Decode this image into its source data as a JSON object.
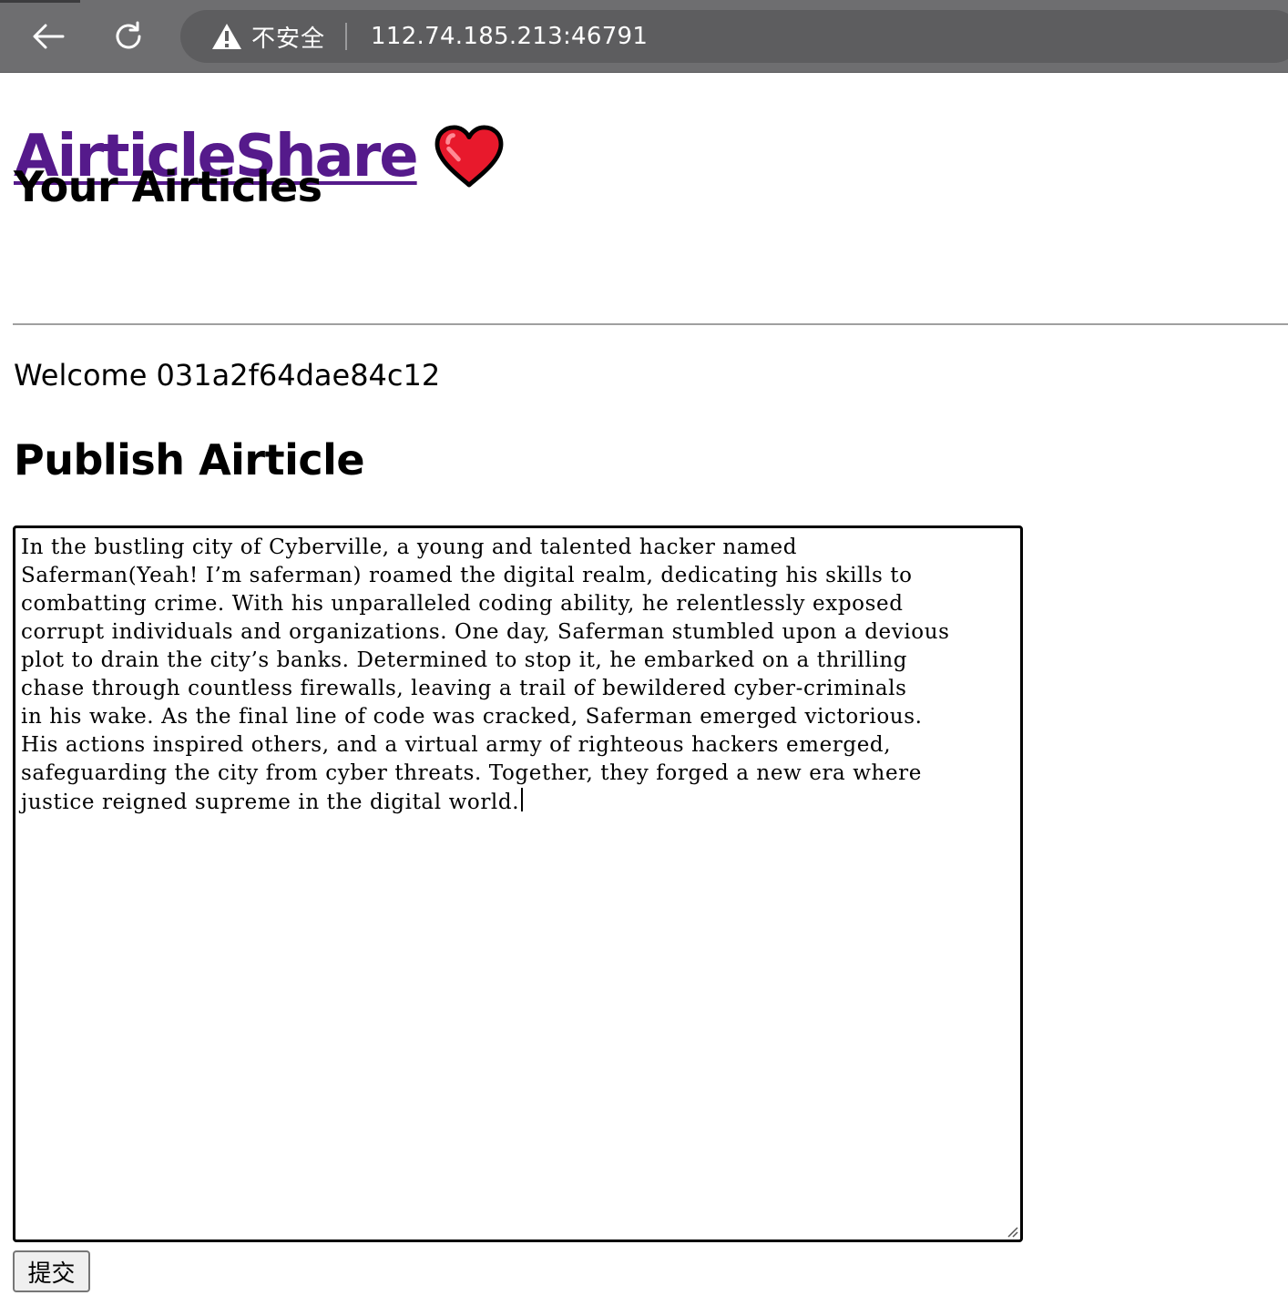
{
  "browser": {
    "security_label": "不安全",
    "url": "112.74.185.213:46791",
    "icons": {
      "back": "arrow-left-icon",
      "reload": "reload-icon",
      "security": "warning-triangle-icon"
    }
  },
  "header": {
    "site_title": "AirticleShare",
    "site_icon": "red-heart-icon"
  },
  "articles": {
    "heading": "Your Airticles"
  },
  "user": {
    "welcome_text": "Welcome 031a2f64dae84c12"
  },
  "publish": {
    "heading": "Publish Airticle",
    "article_lines": [
      "In the bustling city of Cyberville, a young and talented hacker named",
      "Saferman(Yeah! I’m saferman) roamed the digital realm, dedicating his skills to",
      "combatting crime. With his unparalleled coding ability, he relentlessly exposed",
      "corrupt individuals and organizations. One day, Saferman stumbled upon a devious",
      "plot to drain the city’s banks. Determined to stop it, he embarked on a thrilling",
      "chase through countless firewalls, leaving a trail of bewildered cyber-criminals",
      "in his wake. As the final line of code was cracked, Saferman emerged victorious.",
      "His actions inspired others, and a virtual army of righteous hackers emerged,",
      "safeguarding the city from cyber threats. Together, they forged a new era where",
      "justice reigned supreme in the digital world."
    ],
    "submit_label": "提交"
  },
  "colors": {
    "link": "#551a8b",
    "toolbar": "#6e6e70",
    "omnibox": "#5d5d5f",
    "heart": "#e8192c"
  }
}
